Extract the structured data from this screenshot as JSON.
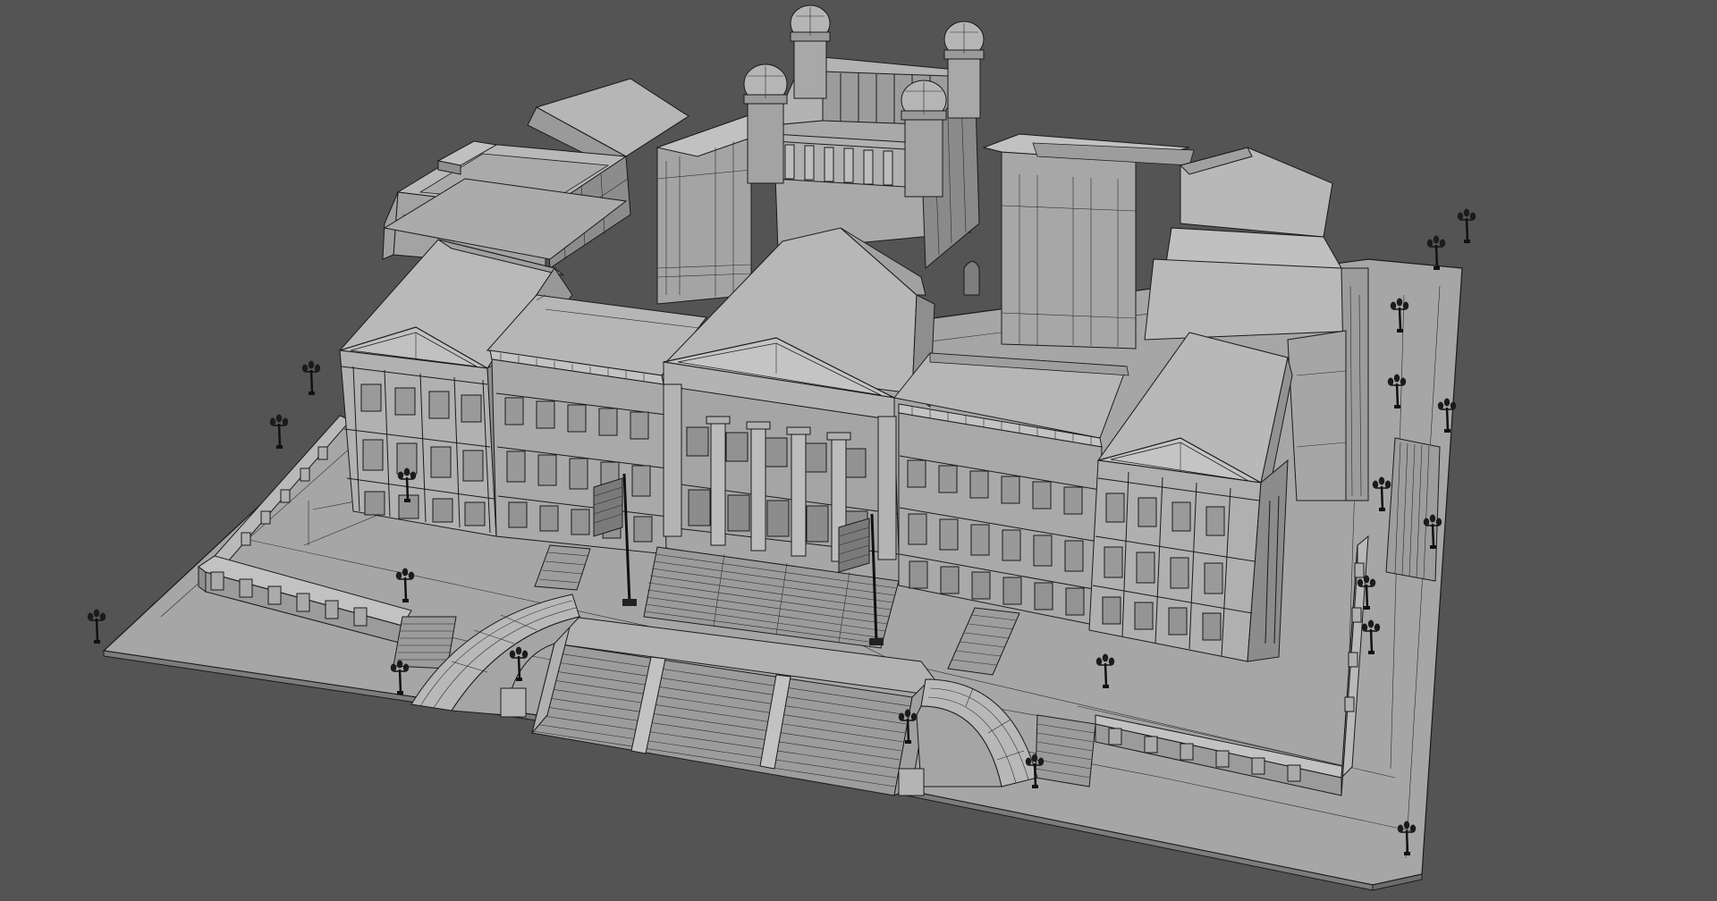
{
  "viewport": {
    "background": "#545454",
    "object": "neoclassical-government-building",
    "shading": "wireframe-on-shaded",
    "material_color": "#a9a9a9"
  },
  "colors": {
    "ground": "#a7a7a7",
    "wall_light": "#b4b4b4",
    "wall_mid": "#9e9e9e",
    "wall_dark": "#8a8a8a",
    "roof_light": "#bdbdbd",
    "roof_dark": "#929292",
    "stairs": "#9a9a9a",
    "edge": "#1a1a1a"
  },
  "lamp_posts": 20,
  "flags": 2
}
